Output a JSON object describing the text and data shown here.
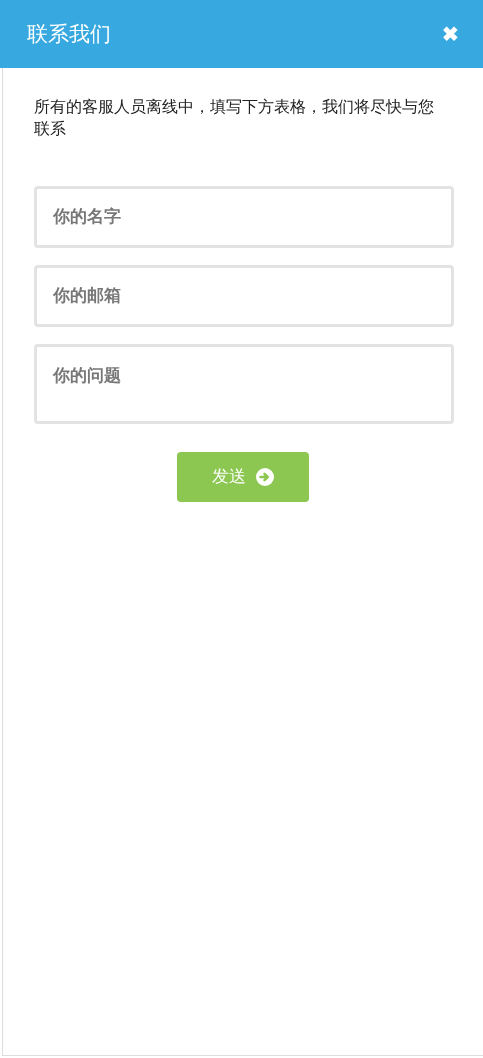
{
  "header": {
    "title": "联系我们",
    "close": "✖"
  },
  "message": "所有的客服人员离线中，填写下方表格，我们将尽快与您联系",
  "fields": [
    {
      "kind": "text",
      "placeholder": "你的名字"
    },
    {
      "kind": "text",
      "placeholder": "你的邮箱"
    },
    {
      "kind": "textarea",
      "placeholder": "你的问题"
    }
  ],
  "submit": {
    "label": "发送"
  }
}
